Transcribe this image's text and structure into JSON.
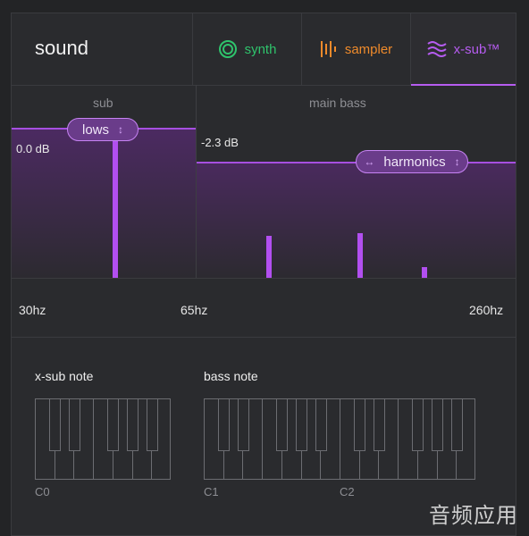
{
  "header": {
    "title": "sound",
    "tabs": [
      {
        "label": "synth",
        "icon": "circle-ring-icon",
        "color": "#2fc36c"
      },
      {
        "label": "sampler",
        "icon": "waveform-bars-icon",
        "color": "#ee8a2b"
      },
      {
        "label": "x-sub™",
        "icon": "wavy-lines-icon",
        "color": "#b65cf0",
        "active": true
      }
    ]
  },
  "spectrum": {
    "regions": [
      {
        "label": "sub",
        "level": "0.0 dB",
        "control": "lows"
      },
      {
        "label": "main bass",
        "level": "-2.3 dB",
        "control": "harmonics"
      }
    ],
    "frequencies": [
      "30hz",
      "65hz",
      "260hz"
    ]
  },
  "keyboards": {
    "xsub": {
      "label": "x-sub note",
      "notes": [
        "C0"
      ]
    },
    "bass": {
      "label": "bass note",
      "notes": [
        "C1",
        "C2"
      ]
    }
  },
  "watermark": "音频应用",
  "colors": {
    "accent": "#b65cf0",
    "background": "#2a2b2e"
  }
}
